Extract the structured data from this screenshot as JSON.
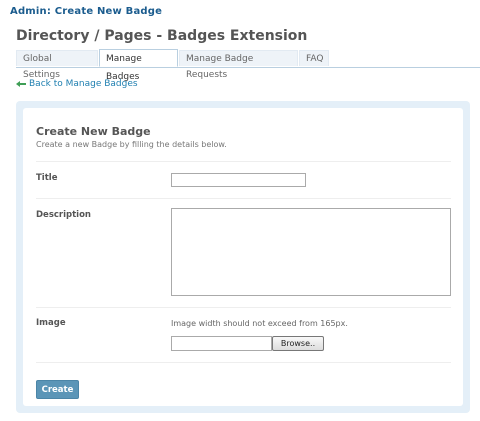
{
  "admin_title": "Admin: Create New Badge",
  "page_heading": "Directory / Pages - Badges Extension",
  "tabs": [
    {
      "label": "Global Settings",
      "active": false
    },
    {
      "label": "Manage Badges",
      "active": true
    },
    {
      "label": "Manage Badge Requests",
      "active": false
    },
    {
      "label": "FAQ",
      "active": false
    }
  ],
  "back_link": "Back to Manage Badges",
  "form": {
    "title": "Create New Badge",
    "description": "Create a new Badge by filling the details below.",
    "fields": {
      "title_label": "Title",
      "title_value": "",
      "description_label": "Description",
      "description_value": "",
      "image_label": "Image",
      "image_hint": "Image width should not exceed from 165px.",
      "browse_label": "Browse..",
      "file_value": ""
    },
    "submit_label": "Create"
  },
  "colors": {
    "accent": "#1b5c8e",
    "link": "#1f7fb0",
    "button": "#5b95b7",
    "panel_bg": "#e4eff8"
  },
  "icons": {
    "back": "arrow-left-icon",
    "resize": "resize-grip-icon"
  }
}
